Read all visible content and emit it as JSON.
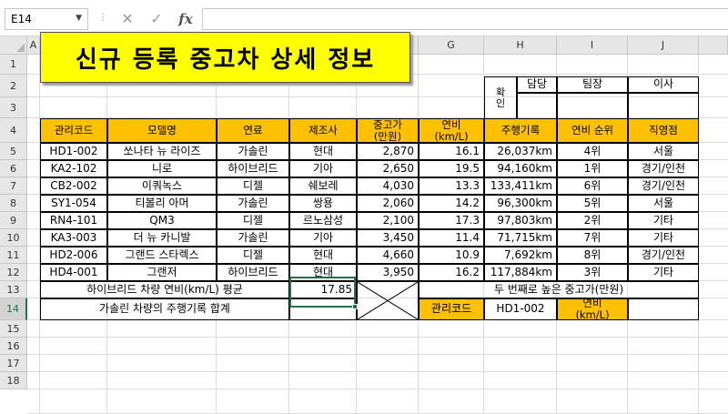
{
  "formula_bar": {
    "name_box": "E14",
    "cancel_icon": "✕",
    "enter_icon": "✓",
    "fx_label": "fx",
    "formula": ""
  },
  "columns": [
    "A",
    "B",
    "C",
    "D",
    "E",
    "F",
    "G",
    "H",
    "I",
    "J"
  ],
  "selected_column": "E",
  "rows": [
    "1",
    "2",
    "3",
    "4",
    "5",
    "6",
    "7",
    "8",
    "9",
    "10",
    "11",
    "12",
    "13",
    "14",
    "15",
    "16",
    "17",
    "18"
  ],
  "selected_row": "14",
  "title": "신규 등록 중고차 상세 정보",
  "approval": {
    "side_label": "확\n인",
    "headers": [
      "담당",
      "팀장",
      "이사"
    ]
  },
  "table": {
    "headers": [
      "관리코드",
      "모델명",
      "연료",
      "제조사",
      "중고가\n(만원)",
      "연비\n(km/L)",
      "주행기록",
      "연비 순위",
      "직영점"
    ],
    "rows": [
      [
        "HD1-002",
        "쏘나타 뉴 라이즈",
        "가솔린",
        "현대",
        "2,870",
        "16.1",
        "26,037km",
        "4위",
        "서울"
      ],
      [
        "KA2-102",
        "니로",
        "하이브리드",
        "기아",
        "2,650",
        "19.5",
        "94,160km",
        "1위",
        "경기/인천"
      ],
      [
        "CB2-002",
        "이쿼녹스",
        "디젤",
        "쉐보레",
        "4,030",
        "13.3",
        "133,411km",
        "6위",
        "경기/인천"
      ],
      [
        "SY1-054",
        "티볼리 아머",
        "가솔린",
        "쌍용",
        "2,060",
        "14.2",
        "96,300km",
        "5위",
        "서울"
      ],
      [
        "RN4-101",
        "QM3",
        "디젤",
        "르노삼성",
        "2,100",
        "17.3",
        "97,803km",
        "2위",
        "기타"
      ],
      [
        "KA3-003",
        "더 뉴 카니발",
        "가솔린",
        "기아",
        "3,450",
        "11.4",
        "71,715km",
        "7위",
        "기타"
      ],
      [
        "HD2-006",
        "그랜드 스타렉스",
        "디젤",
        "현대",
        "4,660",
        "10.9",
        "7,692km",
        "8위",
        "경기/인천"
      ],
      [
        "HD4-001",
        "그랜저",
        "하이브리드",
        "현대",
        "3,950",
        "16.2",
        "117,884km",
        "3위",
        "기타"
      ]
    ]
  },
  "summary": {
    "hybrid_avg_label": "하이브리드 차량 연비(km/L) 평균",
    "hybrid_avg_value": "17.85",
    "second_price_label": "두 번째로 높은 중고가(만원)",
    "gasoline_total_label": "가솔린 차량의 주행기록 합계",
    "gasoline_total_value": "",
    "code_label": "관리코드",
    "code_value": "HD1-002",
    "eff_label": "연비\n(km/L)",
    "eff_value": ""
  },
  "colors": {
    "header_fill": "#ffc000",
    "title_fill": "#ffff00",
    "selection": "#217346"
  }
}
